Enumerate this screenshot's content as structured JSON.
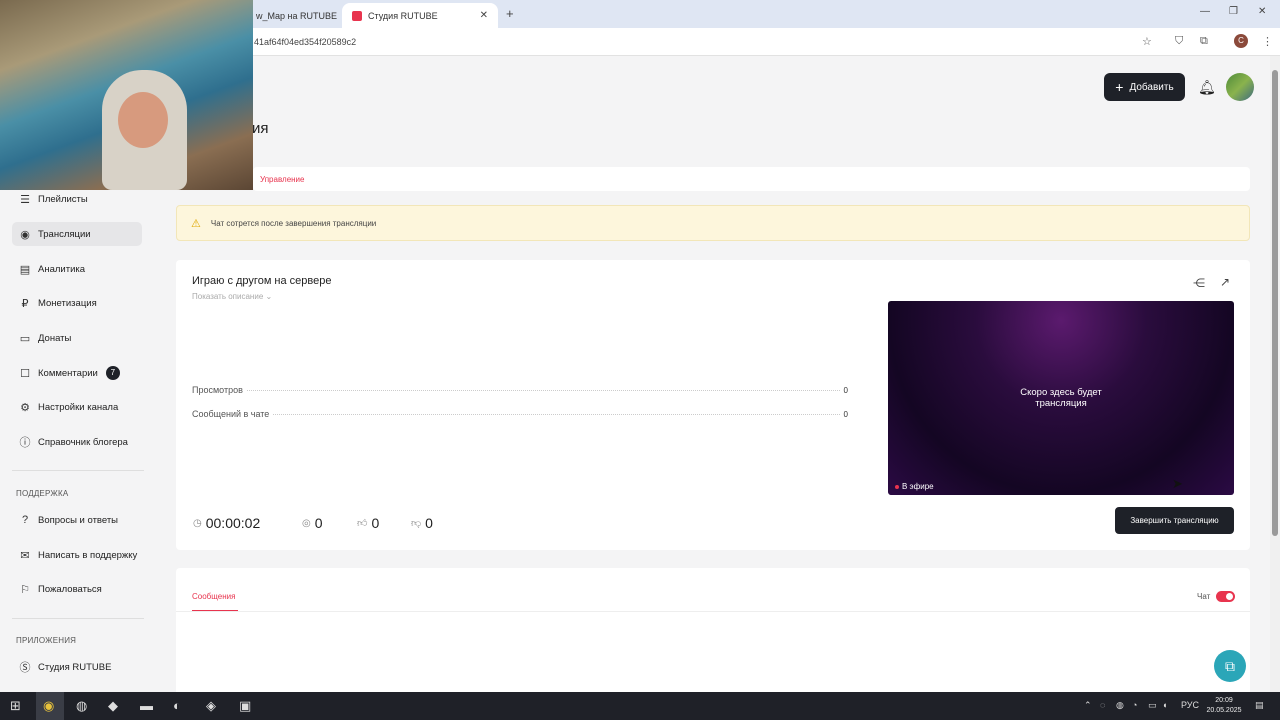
{
  "browser": {
    "tabs": [
      {
        "label": "w_Map на RUTUBE",
        "active": false
      },
      {
        "label": "Студия RUTUBE",
        "active": true
      }
    ],
    "url": "41af64f04ed354f20589c2"
  },
  "header": {
    "add_button": "Добавить",
    "page_title": "ия"
  },
  "tabs": {
    "manage": "Управление"
  },
  "sidebar": {
    "items": [
      {
        "label": "Плейлисты",
        "icon": "playlist-icon"
      },
      {
        "label": "Трансляции",
        "icon": "broadcast-icon",
        "active": true
      },
      {
        "label": "Аналитика",
        "icon": "analytics-icon"
      },
      {
        "label": "Монетизация",
        "icon": "ruble-icon"
      },
      {
        "label": "Донаты",
        "icon": "donate-icon"
      },
      {
        "label": "Комментарии",
        "icon": "comment-icon",
        "badge": "7"
      },
      {
        "label": "Настройки канала",
        "icon": "gear-icon"
      },
      {
        "label": "Справочник блогера",
        "icon": "info-icon"
      }
    ],
    "support_label": "ПОДДЕРЖКА",
    "support_items": [
      {
        "label": "Вопросы и ответы",
        "icon": "faq-icon"
      },
      {
        "label": "Написать в поддержку",
        "icon": "mail-icon"
      },
      {
        "label": "Пожаловаться",
        "icon": "flag-icon"
      }
    ],
    "apps_label": "ПРИЛОЖЕНИЯ",
    "apps_items": [
      {
        "label": "Студия RUTUBE",
        "icon": "studio-icon"
      }
    ]
  },
  "warning": {
    "text": "Чат сотрется после завершения трансляции"
  },
  "stream": {
    "title": "Играю с другом на сервере",
    "show_description": "Показать описание",
    "stats": [
      {
        "label": "Просмотров",
        "value": "0"
      },
      {
        "label": "Сообщений в чате",
        "value": "0"
      }
    ],
    "player_message": "Скоро здесь будет трансляция",
    "live_label": "В эфире",
    "timer": "00:00:02",
    "viewers": "0",
    "likes": "0",
    "dislikes": "0",
    "end_button": "Завершить трансляцию"
  },
  "messages": {
    "tab": "Сообщения",
    "chat_label": "Чат",
    "chat_enabled": true
  },
  "taskbar": {
    "lang": "РУС",
    "time": "20:09",
    "date": "20.05.2025"
  },
  "colors": {
    "accent": "#e8344e",
    "dark_button": "#1e2128",
    "warning_bg": "#fdf6dc"
  }
}
